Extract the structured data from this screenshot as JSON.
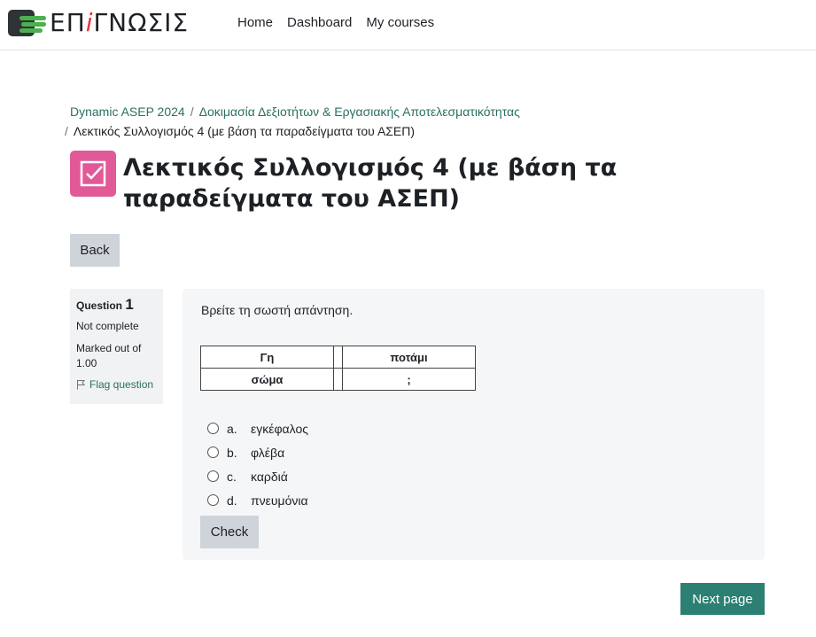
{
  "header": {
    "logo_prefix": "ΕΠ",
    "logo_accent": "i",
    "logo_suffix": "ΓΝΩΣΙΣ",
    "nav": [
      "Home",
      "Dashboard",
      "My courses"
    ]
  },
  "breadcrumb": {
    "items": [
      "Dynamic ASEP 2024",
      "Δοκιμασία Δεξιοτήτων & Εργασιακής Αποτελεσματικότητας"
    ],
    "current": "Λεκτικός Συλλογισμός 4 (με βάση τα παραδείγματα του ΑΣΕΠ)",
    "separator": "/"
  },
  "page": {
    "title": "Λεκτικός Συλλογισμός 4 (με βάση τα παραδείγματα του ΑΣΕΠ)",
    "back_label": "Back",
    "next_label": "Next page"
  },
  "question": {
    "label": "Question",
    "number": "1",
    "state": "Not complete",
    "grade": "Marked out of 1.00",
    "flag_label": "Flag question",
    "text": "Βρείτε τη σωστή απάντηση.",
    "table": [
      [
        "Γη",
        "",
        "ποτάμι"
      ],
      [
        "σώμα",
        "",
        ";"
      ]
    ],
    "answers": [
      {
        "letter": "a.",
        "text": "εγκέφαλος"
      },
      {
        "letter": "b.",
        "text": "φλέβα"
      },
      {
        "letter": "c.",
        "text": "καρδιά"
      },
      {
        "letter": "d.",
        "text": "πνευμόνια"
      }
    ],
    "check_label": "Check"
  },
  "colors": {
    "accent_link": "#2a6f62",
    "module_icon_bg": "#e15a97",
    "next_button_bg": "#2b7f73"
  }
}
